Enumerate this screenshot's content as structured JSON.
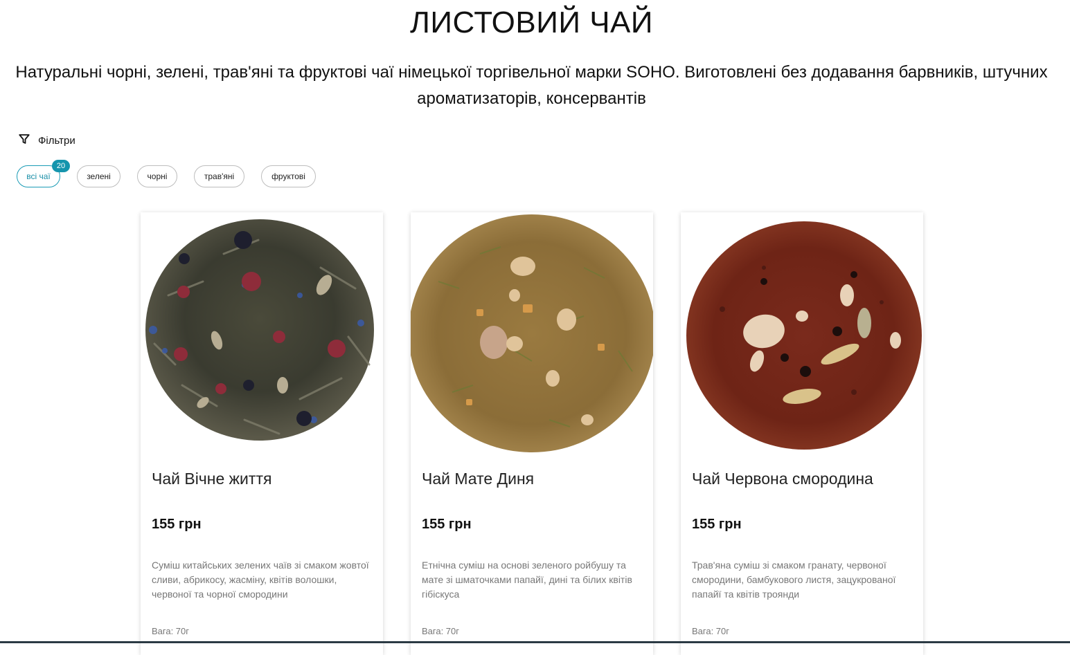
{
  "page": {
    "title": "ЛИСТОВИЙ ЧАЙ",
    "subtitle": "Натуральні чорні, зелені, трав'яні та фруктові чаї німецької торгівельної марки SOHO. Виготовлені без додавання барвників, штучних ароматизаторів, консервантів"
  },
  "filters": {
    "label": "Фільтри",
    "icon": "filter-icon",
    "chips": [
      {
        "label": "всі чаї",
        "active": true,
        "badge": "20"
      },
      {
        "label": "зелені",
        "active": false
      },
      {
        "label": "чорні",
        "active": false
      },
      {
        "label": "трав'яні",
        "active": false
      },
      {
        "label": "фруктові",
        "active": false
      }
    ]
  },
  "colors": {
    "accent": "#1595ad",
    "text": "#111111",
    "muted": "#777777"
  },
  "products": [
    {
      "name": "Чай Вічне життя",
      "price": "155 грн",
      "description": "Суміш китайських зелених чаїв зі смаком жовтої сливи, абрикосу, жасміну, квітів волошки, червоної та чорної смородини",
      "weight": "Вага: 70г",
      "image": "green-tea-blend-image"
    },
    {
      "name": "Чай Мате Диня",
      "price": "155 грн",
      "description": "Етнічна суміш на основі зеленого ройбушу та мате зі шматочками папайї, дині та білих квітів гібіскуса",
      "weight": "Вага: 70г",
      "image": "mate-tea-image"
    },
    {
      "name": "Чай Червона смородина",
      "price": "155 грн",
      "description": "Трав'яна суміш зі смаком гранату, червоної смородини, бамбукового листя, зацукрованої папайї та квітів троянди",
      "weight": "Вага: 70г",
      "image": "rooibos-tea-image"
    }
  ]
}
